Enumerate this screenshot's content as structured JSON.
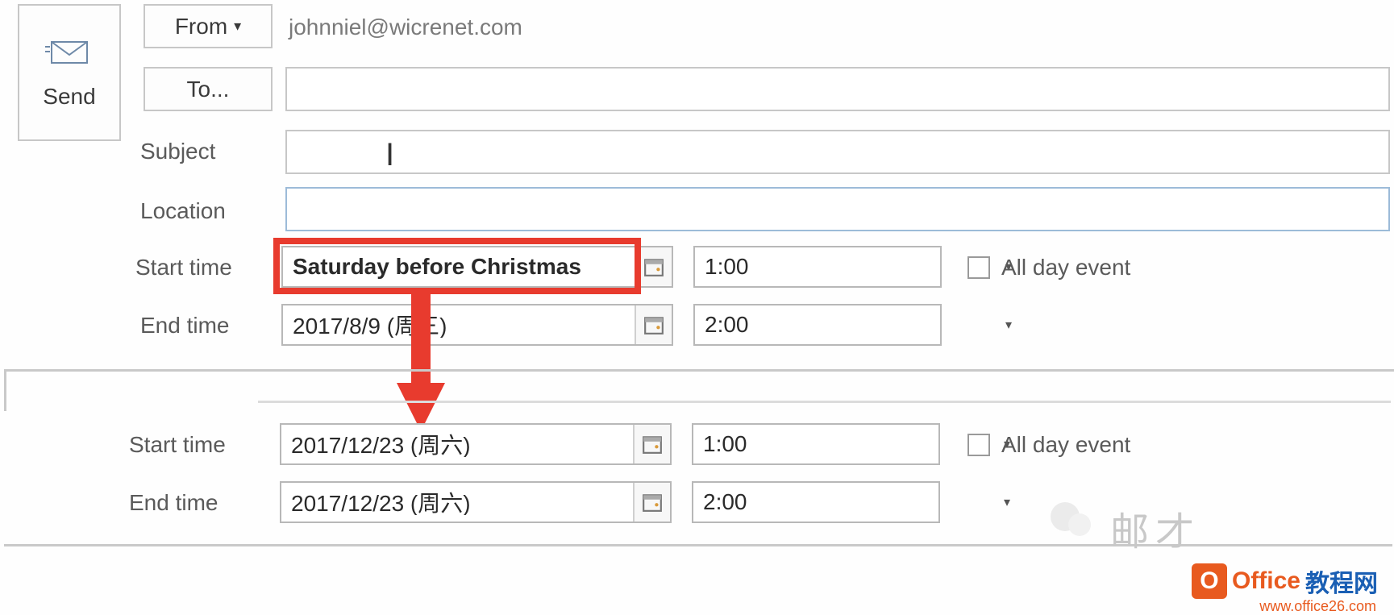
{
  "send": {
    "label": "Send"
  },
  "from": {
    "button_label": "From",
    "value": "johnniel@wicrenet.com"
  },
  "to": {
    "button_label": "To...",
    "value": ""
  },
  "subject": {
    "label": "Subject",
    "value": ""
  },
  "location": {
    "label": "Location",
    "value": ""
  },
  "section1": {
    "start": {
      "label": "Start time",
      "date": "Saturday before Christmas",
      "time": "1:00"
    },
    "end": {
      "label": "End time",
      "date": "2017/8/9 (周三)",
      "time": "2:00"
    },
    "allday_label": "All day event",
    "allday_checked": false
  },
  "section2": {
    "start": {
      "label": "Start time",
      "date": "2017/12/23 (周六)",
      "time": "1:00"
    },
    "end": {
      "label": "End time",
      "date": "2017/12/23 (周六)",
      "time": "2:00"
    },
    "allday_label": "All day event",
    "allday_checked": false
  },
  "watermark": {
    "zh": "邮才",
    "brand_orange": "Office",
    "brand_blue": "教程网",
    "url": "www.office26.com"
  }
}
